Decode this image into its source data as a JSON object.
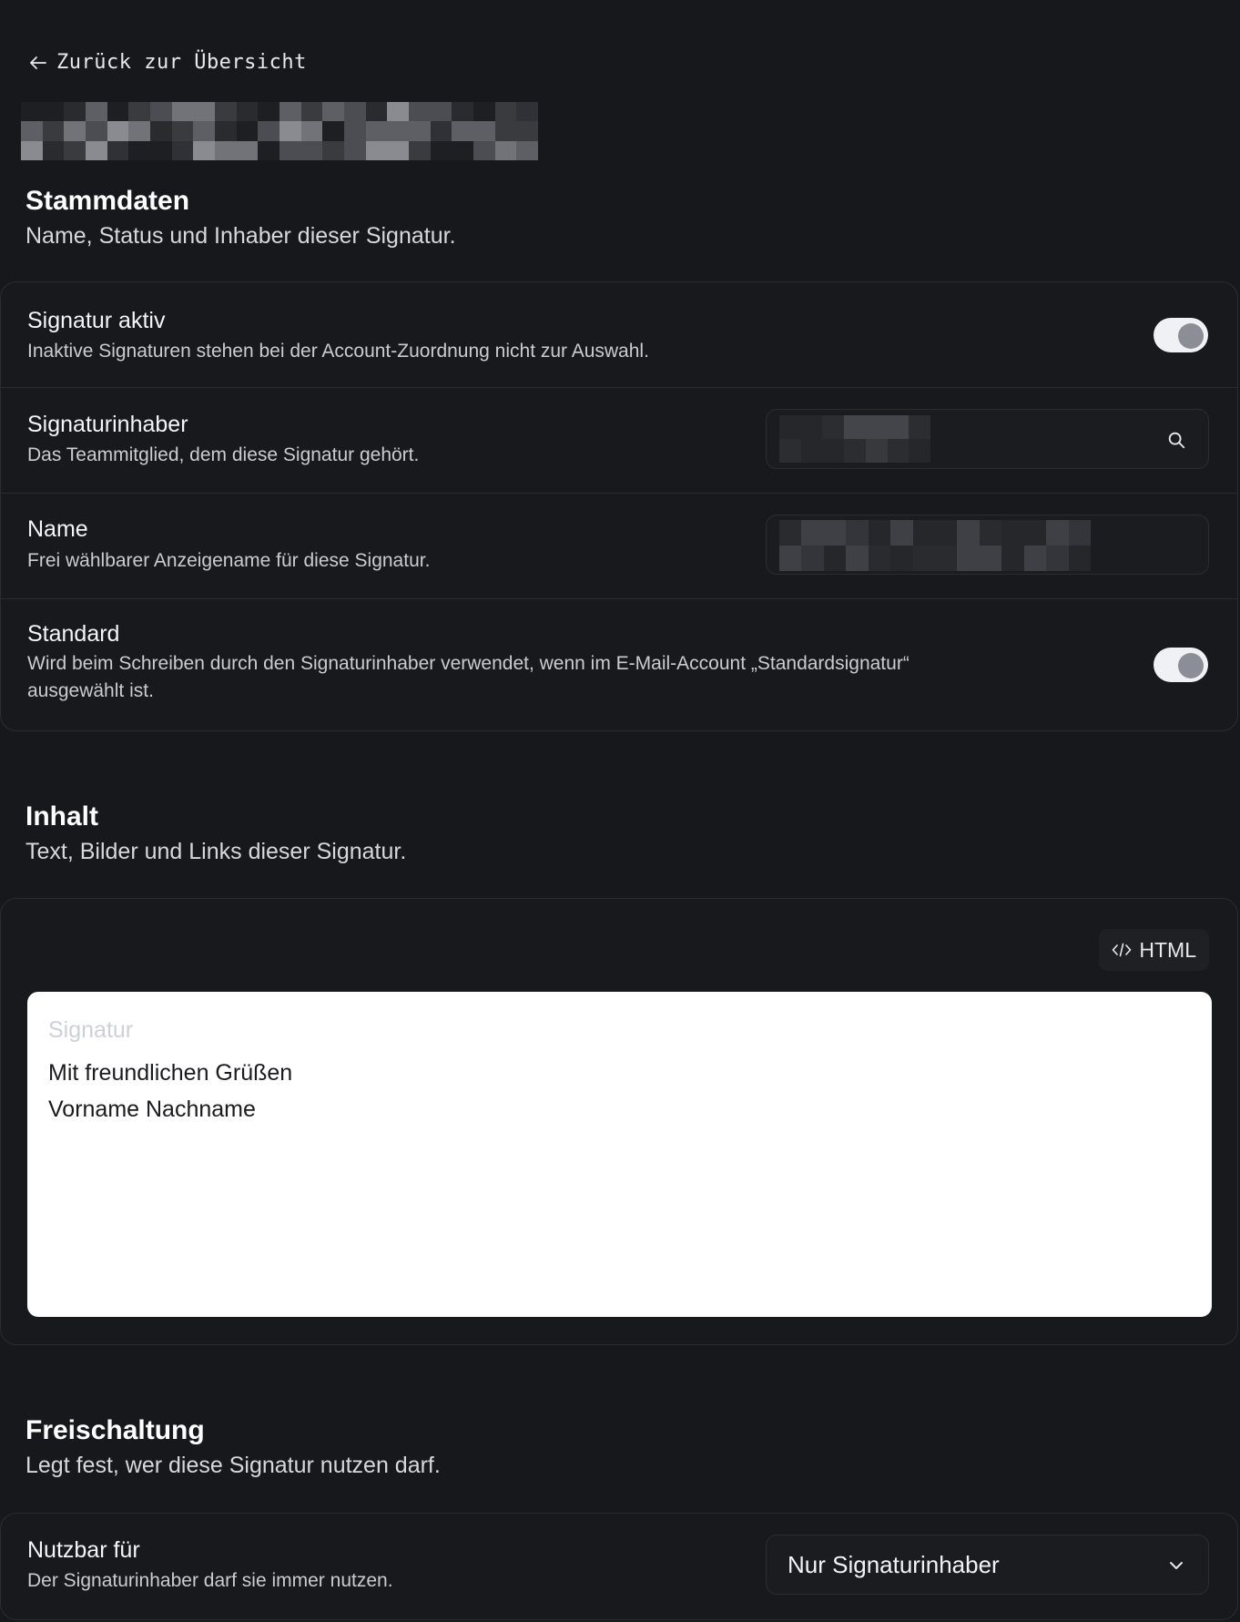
{
  "nav": {
    "back_label": "Zurück zur Übersicht"
  },
  "stammdaten": {
    "title": "Stammdaten",
    "subtitle": "Name, Status und Inhaber dieser Signatur.",
    "rows": [
      {
        "label": "Signatur aktiv",
        "desc": "Inaktive Signaturen stehen bei der Account-Zuordnung nicht zur Auswahl.",
        "toggle_on": true
      },
      {
        "label": "Signaturinhaber",
        "desc": "Das Teammitglied, dem diese Signatur gehört."
      },
      {
        "label": "Name",
        "desc": "Frei wählbarer Anzeigename für diese Signatur."
      },
      {
        "label": "Standard",
        "desc_line1": "Wird beim Schreiben durch den Signaturinhaber verwendet, wenn im E-Mail-Account „Standardsignatur“",
        "desc_line2": "ausgewählt ist.",
        "toggle_on": true
      }
    ]
  },
  "inhalt": {
    "title": "Inhalt",
    "subtitle": "Text, Bilder und Links dieser Signatur.",
    "html_button": "HTML",
    "editor_placeholder": "Signatur",
    "editor_lines": [
      "Mit freundlichen Grüßen",
      "Vorname Nachname"
    ]
  },
  "freischaltung": {
    "title": "Freischaltung",
    "subtitle": "Legt fest, wer diese Signatur nutzen darf.",
    "row": {
      "label": "Nutzbar für",
      "desc": "Der Signaturinhaber darf sie immer nutzen.",
      "select_value": "Nur Signaturinhaber"
    }
  },
  "icons": {
    "back": "arrow-left-icon",
    "search": "search-icon",
    "code": "code-icon",
    "chevron": "chevron-down-icon"
  },
  "colors": {
    "background": "#17181b",
    "card_border": "#2a2c31",
    "toggle_track": "#f0f1f4",
    "toggle_knob": "#8b8e97",
    "editor_bg": "#ffffff"
  }
}
